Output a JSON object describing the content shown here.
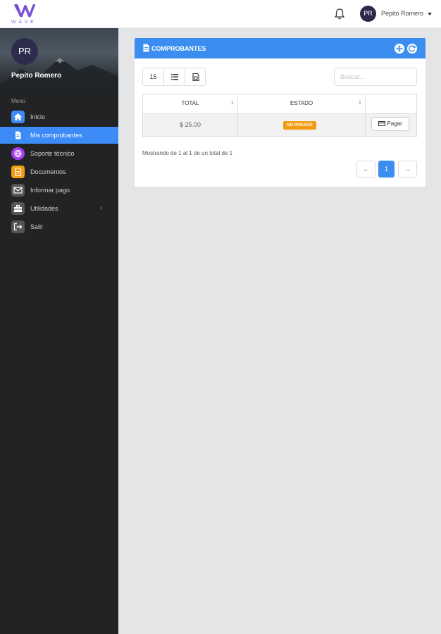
{
  "brand": {
    "logo_text": "WAVE",
    "accent": "#7a4fd3"
  },
  "topbar": {
    "user_initials": "PR",
    "user_name": "Pepito Romero",
    "bell_icon": "bell-icon"
  },
  "sidebar": {
    "avatar_initials": "PR",
    "profile_name": "Pepito Romero",
    "menu_label": "Menú",
    "items": [
      {
        "label": "Inicio",
        "icon": "home-icon",
        "color": "#3d8bf7",
        "active": false
      },
      {
        "label": "Mis comprobantes",
        "icon": "document-icon",
        "color": "#3d8bf7",
        "active": true
      },
      {
        "label": "Soporte técnico",
        "icon": "globe-icon",
        "color": "#a83cf0",
        "active": false
      },
      {
        "label": "Documentos",
        "icon": "file-icon",
        "color": "#f39c12",
        "active": false
      },
      {
        "label": "Informar pago",
        "icon": "mail-icon",
        "color": "#555555",
        "active": false
      },
      {
        "label": "Utilidades",
        "icon": "toolbox-icon",
        "color": "#555555",
        "active": false
      },
      {
        "label": "Salir",
        "icon": "logout-icon",
        "color": "#555555",
        "active": false
      }
    ]
  },
  "card": {
    "title": "COMPROBANTES",
    "toolbar": {
      "page_size": "15"
    },
    "search_placeholder": "Buscar...",
    "columns": [
      "TOTAL",
      "ESTADO",
      ""
    ],
    "rows": [
      {
        "total": "$ 25.00",
        "estado": "NO PAGADO",
        "action": "Pagar"
      }
    ],
    "status_color": "#f39c12",
    "showing_text": "Mostrando de 1 al 1 de un total de 1",
    "pagination": {
      "current": "1",
      "prev": "←",
      "next": "→"
    }
  }
}
